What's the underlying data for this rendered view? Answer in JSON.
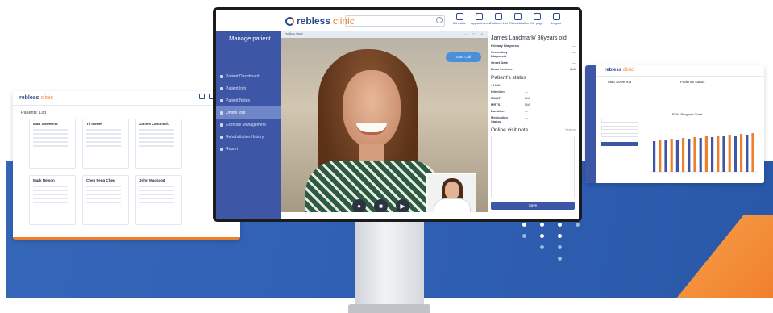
{
  "app": {
    "logo_brand": "rebless",
    "logo_accent": "clinic",
    "nav": [
      "Schedule",
      "Appointments",
      "Patients List",
      "Rehabilitation",
      "My page",
      "Logout"
    ]
  },
  "sidebar": {
    "title": "Manage patient",
    "items": [
      {
        "label": "Patient Dashboard",
        "active": false
      },
      {
        "label": "Patient Info",
        "active": false
      },
      {
        "label": "Patient Notes",
        "active": false
      },
      {
        "label": "Online visit",
        "active": true
      },
      {
        "label": "Exercise Management",
        "active": false
      },
      {
        "label": "Rehabilitation History",
        "active": false
      },
      {
        "label": "Report",
        "active": false
      }
    ]
  },
  "visit": {
    "header": "Online Visit",
    "window_controls": "– □ ×",
    "start_call": "Start Call",
    "controls": [
      "microphone-icon",
      "camera-icon",
      "speaker-icon"
    ]
  },
  "patient": {
    "name": "James Landmark/ 36years old",
    "info": [
      {
        "label": "Primary Diagnosis",
        "value": "—"
      },
      {
        "label": "Secondary Diagnosis",
        "value": "—"
      },
      {
        "label": "Onset Date",
        "value": "—"
      },
      {
        "label": "Brain Lesions",
        "value": "N/A"
      }
    ],
    "status_title": "Patient's status",
    "status": [
      {
        "label": "ALVAI",
        "value": "—"
      },
      {
        "label": "Infection",
        "value": "—"
      },
      {
        "label": "MMAT",
        "value": "N/A"
      },
      {
        "label": "MRTS",
        "value": "N/A"
      },
      {
        "label": "Duration",
        "value": "—"
      },
      {
        "label": "Medication Status",
        "value": "—"
      }
    ],
    "note_title": "Online visit note",
    "note_hint": "History",
    "save": "Save"
  },
  "left_card": {
    "title": "Patients' List",
    "patients": [
      "Matt Sowerma",
      "Til Nowel",
      "James Landmark",
      "Mark Nelson",
      "Chen Feng Chen",
      "John Madsport"
    ]
  },
  "right_card": {
    "name": "Matt Sowerma",
    "status": "Patient's status",
    "chart_title": "ROM Progress Chart"
  },
  "colors": {
    "brand_blue": "#3d56a6",
    "accent_orange": "#f07f2c",
    "band_blue": "#3566b8"
  }
}
